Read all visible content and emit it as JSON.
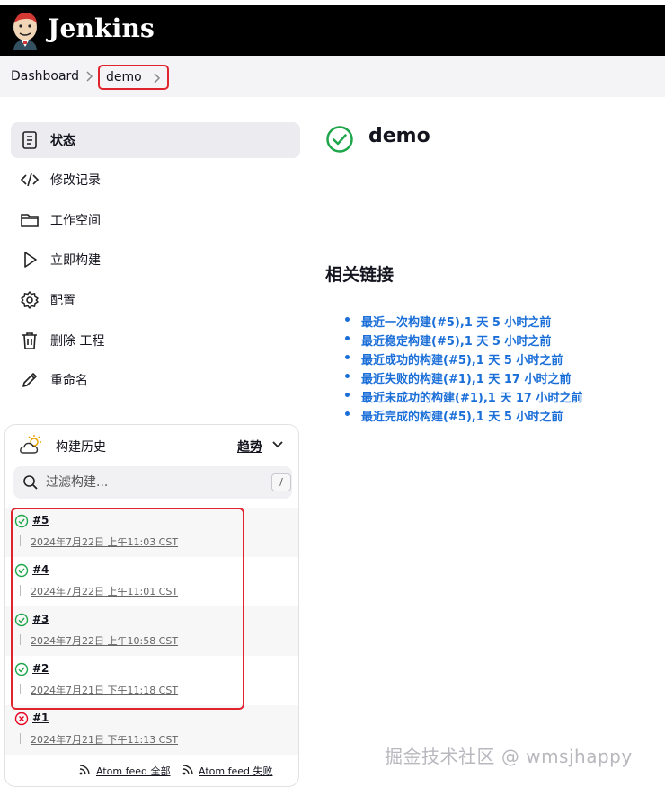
{
  "header": {
    "title": "Jenkins",
    "logo_icon": "jenkins-butler-logo"
  },
  "breadcrumb": {
    "items": [
      "Dashboard",
      "demo"
    ]
  },
  "sidebar": {
    "items": [
      {
        "label": "状态",
        "icon": "document-icon",
        "active": true
      },
      {
        "label": "修改记录",
        "icon": "code-icon"
      },
      {
        "label": "工作空间",
        "icon": "folder-icon"
      },
      {
        "label": "立即构建",
        "icon": "play-icon"
      },
      {
        "label": "配置",
        "icon": "gear-icon"
      },
      {
        "label": "删除 工程",
        "icon": "trash-icon"
      },
      {
        "label": "重命名",
        "icon": "pencil-icon"
      }
    ]
  },
  "main": {
    "project_name": "demo",
    "status": "success",
    "links_title": "相关链接",
    "links": [
      "最近一次构建(#5),1 天 5 小时之前",
      "最近稳定构建(#5),1 天 5 小时之前",
      "最近成功的构建(#5),1 天 5 小时之前",
      "最近失败的构建(#1),1 天 17 小时之前",
      "最近未成功的构建(#1),1 天 17 小时之前",
      "最近完成的构建(#5),1 天 5 小时之前"
    ]
  },
  "build_history": {
    "title": "构建历史",
    "trend_label": "趋势",
    "filter_placeholder": "过滤构建...",
    "filter_shortcut": "/",
    "builds": [
      {
        "number": "#5",
        "time": "2024年7月22日 上午11:03 CST",
        "status": "success"
      },
      {
        "number": "#4",
        "time": "2024年7月22日 上午11:01 CST",
        "status": "success"
      },
      {
        "number": "#3",
        "time": "2024年7月22日 上午10:58 CST",
        "status": "success"
      },
      {
        "number": "#2",
        "time": "2024年7月21日 下午11:18 CST",
        "status": "success"
      },
      {
        "number": "#1",
        "time": "2024年7月21日 下午11:13 CST",
        "status": "failed"
      }
    ],
    "feeds": [
      "Atom feed 全部",
      "Atom feed 失败"
    ]
  },
  "watermark": "掘金技术社区 @ wmsjhappy",
  "colors": {
    "success": "#1ea64b",
    "failed": "#e6001f",
    "link": "#1a6ed8",
    "highlight": "#e0242e"
  }
}
